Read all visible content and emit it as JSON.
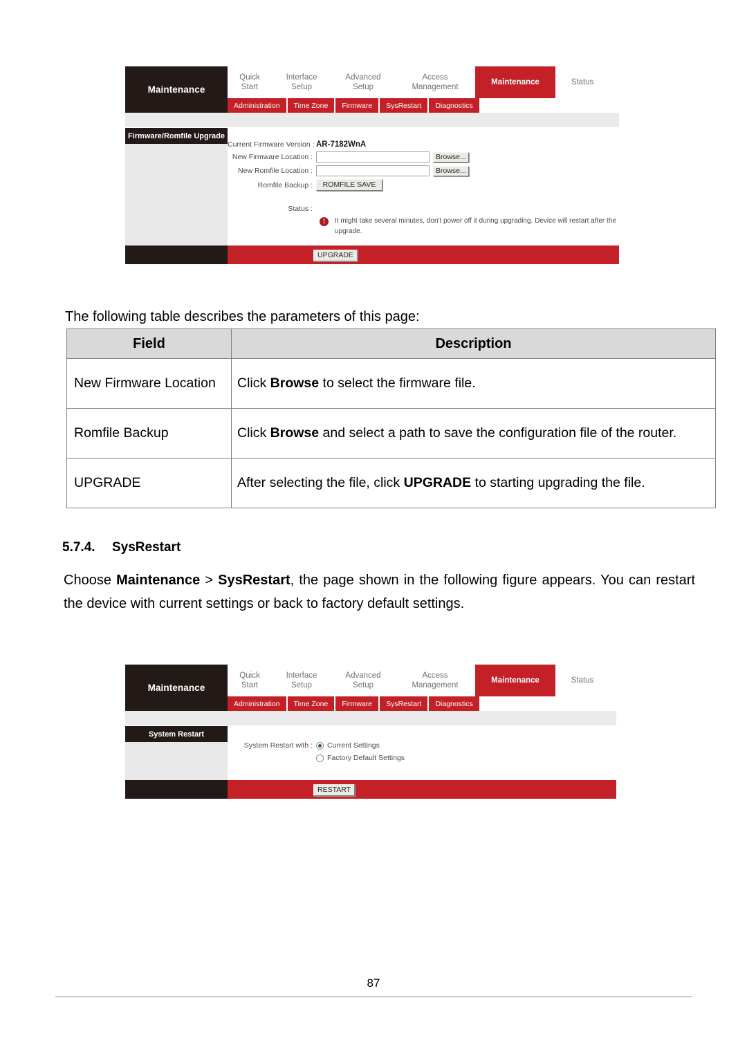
{
  "colors": {
    "brand_red": "#c32027",
    "brand_dark": "#231a17",
    "panel_gray": "#e8e8e8",
    "table_header_gray": "#d9d9d9",
    "warn_red": "#a81a21"
  },
  "figure_firmware": {
    "brand": "Maintenance",
    "nav_tabs": [
      {
        "line1": "Quick",
        "line2": "Start",
        "active": false
      },
      {
        "line1": "Interface",
        "line2": "Setup",
        "active": false
      },
      {
        "line1": "Advanced",
        "line2": "Setup",
        "active": false
      },
      {
        "line1": "Access",
        "line2": "Management",
        "active": false
      },
      {
        "line1": "Maintenance",
        "line2": "",
        "active": true
      },
      {
        "line1": "Status",
        "line2": "",
        "active": false
      }
    ],
    "subnav": [
      "Administration",
      "Time Zone",
      "Firmware",
      "SysRestart",
      "Diagnostics"
    ],
    "panel_title": "Firmware/Romfile Upgrade",
    "fields": {
      "current_firmware_label": "Current Firmware Version :",
      "current_firmware_value": "AR-7182WnA",
      "new_firmware_label": "New Firmware Location :",
      "new_firmware_value": "",
      "new_firmware_placeholder": "",
      "new_romfile_label": "New Romfile Location :",
      "new_romfile_value": "",
      "new_romfile_placeholder": "",
      "romfile_backup_label": "Romfile Backup :",
      "romfile_save_button": "ROMFILE SAVE",
      "browse_button": "Browse...",
      "status_label": "Status :",
      "status_icon": "warning-exclamation-icon",
      "status_note": "It might take several minutes, don't power off it during upgrading. Device will restart after the upgrade.",
      "upgrade_button": "UPGRADE"
    }
  },
  "body_text": {
    "intro": "The following table describes the parameters of this page:"
  },
  "param_table": {
    "headers": [
      "Field",
      "Description"
    ],
    "rows": [
      {
        "field": "New Firmware Location",
        "desc_pre": "Click ",
        "desc_bold": "Browse",
        "desc_post": " to select the firmware file.",
        "justify": false
      },
      {
        "field": "Romfile Backup",
        "desc_pre": "Click ",
        "desc_bold": "Browse",
        "desc_post": " and select a path to save the configuration file of the router.",
        "justify": true
      },
      {
        "field": "UPGRADE",
        "desc_pre": "After selecting the file, click ",
        "desc_bold": "UPGRADE",
        "desc_post": " to starting upgrading the file.",
        "justify": true
      }
    ]
  },
  "section": {
    "number": "5.7.4.",
    "title": "SysRestart",
    "para_pre": "Choose ",
    "para_bold1": "Maintenance",
    "para_mid": " > ",
    "para_bold2": "SysRestart",
    "para_post": ", the page shown in the following figure appears. You can restart the device with current settings or back to factory default settings."
  },
  "figure_sysrestart": {
    "brand": "Maintenance",
    "nav_tabs": [
      {
        "line1": "Quick",
        "line2": "Start",
        "active": false
      },
      {
        "line1": "Interface",
        "line2": "Setup",
        "active": false
      },
      {
        "line1": "Advanced",
        "line2": "Setup",
        "active": false
      },
      {
        "line1": "Access",
        "line2": "Management",
        "active": false
      },
      {
        "line1": "Maintenance",
        "line2": "",
        "active": true
      },
      {
        "line1": "Status",
        "line2": "",
        "active": false
      }
    ],
    "subnav": [
      "Administration",
      "Time Zone",
      "Firmware",
      "SysRestart",
      "Diagnostics"
    ],
    "panel_title": "System Restart",
    "fields": {
      "restart_with_label": "System Restart with :",
      "option_current": "Current Settings",
      "option_factory": "Factory Default Settings",
      "selected_option": "Current Settings",
      "restart_button": "RESTART"
    }
  },
  "page": {
    "number": "87"
  }
}
